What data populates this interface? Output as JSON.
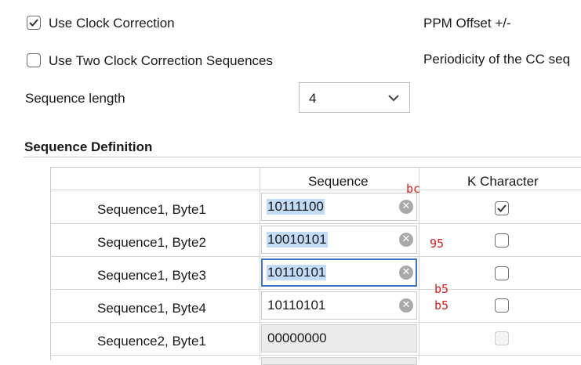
{
  "options": {
    "use_clock_correction": {
      "label": "Use Clock Correction",
      "checked": true
    },
    "use_two_sequences": {
      "label": "Use Two Clock Correction Sequences",
      "checked": false
    },
    "ppm_offset_label": "PPM Offset +/-",
    "periodicity_label": "Periodicity of the CC seq",
    "sequence_length": {
      "label": "Sequence length",
      "value": "4"
    }
  },
  "section": {
    "title": "Sequence Definition"
  },
  "table": {
    "headers": {
      "row_label": "",
      "sequence": "Sequence",
      "k_character": "K Character"
    },
    "rows": [
      {
        "label": "Sequence1, Byte1",
        "value": "10111100",
        "k_checked": true,
        "k_disabled": false
      },
      {
        "label": "Sequence1, Byte2",
        "value": "10010101",
        "k_checked": false,
        "k_disabled": false
      },
      {
        "label": "Sequence1, Byte3",
        "value": "10110101",
        "k_checked": false,
        "k_disabled": false
      },
      {
        "label": "Sequence1, Byte4",
        "value": "10110101",
        "k_checked": false,
        "k_disabled": false
      },
      {
        "label": "Sequence2, Byte1",
        "value": "00000000",
        "k_checked": false,
        "k_disabled": true
      }
    ]
  },
  "annotations": [
    "bc",
    "95",
    "b5",
    "b5"
  ],
  "colors": {
    "selection": "#c2dbf7",
    "focus": "#3d74c4",
    "annotation": "#d62020"
  }
}
